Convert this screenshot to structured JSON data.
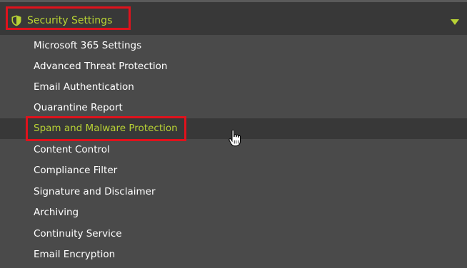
{
  "header": {
    "title": "Security Settings",
    "icon": "shield-icon",
    "toggle_icon": "chevron-down-icon",
    "expanded": true
  },
  "menu": {
    "items": [
      {
        "label": "Microsoft 365 Settings",
        "active": false
      },
      {
        "label": "Advanced Threat Protection",
        "active": false
      },
      {
        "label": "Email Authentication",
        "active": false
      },
      {
        "label": "Quarantine Report",
        "active": false
      },
      {
        "label": "Spam and Malware Protection",
        "active": true
      },
      {
        "label": "Content Control",
        "active": false
      },
      {
        "label": "Compliance Filter",
        "active": false
      },
      {
        "label": "Signature and Disclaimer",
        "active": false
      },
      {
        "label": "Archiving",
        "active": false
      },
      {
        "label": "Continuity Service",
        "active": false
      },
      {
        "label": "Email Encryption",
        "active": false
      }
    ]
  },
  "colors": {
    "background": "#4a4a4a",
    "header_background": "#383838",
    "accent": "#b8d235",
    "highlight_border": "#e0121c",
    "text": "#ffffff"
  },
  "cursor": "hand-pointer-icon"
}
